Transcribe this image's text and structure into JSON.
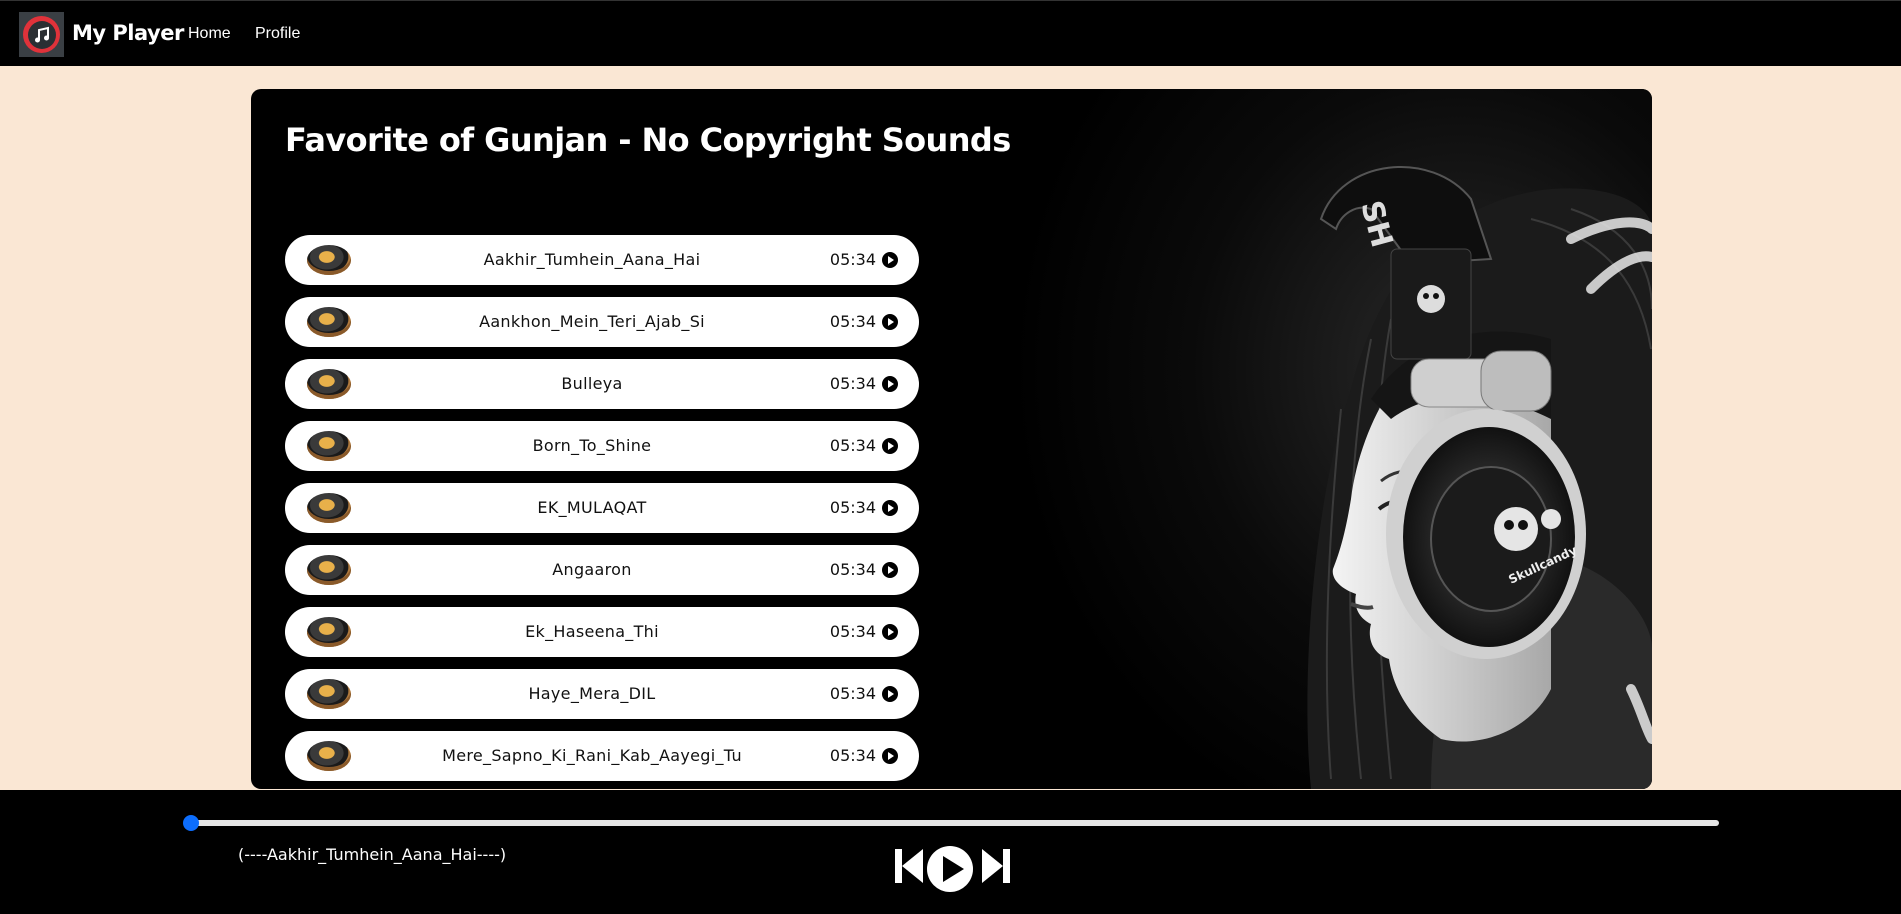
{
  "navbar": {
    "brand": "My Player",
    "links": [
      "Home",
      "Profile"
    ]
  },
  "playlist": {
    "title": "Favorite of Gunjan - No Copyright Sounds",
    "songs": [
      {
        "name": "Aakhir_Tumhein_Aana_Hai",
        "duration": "05:34"
      },
      {
        "name": "Aankhon_Mein_Teri_Ajab_Si",
        "duration": "05:34"
      },
      {
        "name": "Bulleya",
        "duration": "05:34"
      },
      {
        "name": "Born_To_Shine",
        "duration": "05:34"
      },
      {
        "name": "EK_MULAQAT",
        "duration": "05:34"
      },
      {
        "name": "Angaaron",
        "duration": "05:34"
      },
      {
        "name": "Ek_Haseena_Thi",
        "duration": "05:34"
      },
      {
        "name": "Haye_Mera_DIL",
        "duration": "05:34"
      },
      {
        "name": "Mere_Sapno_Ki_Rani_Kab_Aayegi_Tu",
        "duration": "05:34"
      }
    ]
  },
  "player": {
    "now_playing": "(----Aakhir_Tumhein_Aana_Hai----)",
    "progress": 0,
    "accent_color": "#0d6efd"
  },
  "colors": {
    "page_background": "#fae7d4",
    "navbar": "#000000",
    "card": "#000000"
  },
  "icons": {
    "logo": "music-note-icon",
    "song_thumb": "vinyl-record-icon",
    "song_play": "play-circle-icon",
    "prev": "skip-previous-icon",
    "play": "play-circle-icon",
    "next": "skip-next-icon"
  }
}
